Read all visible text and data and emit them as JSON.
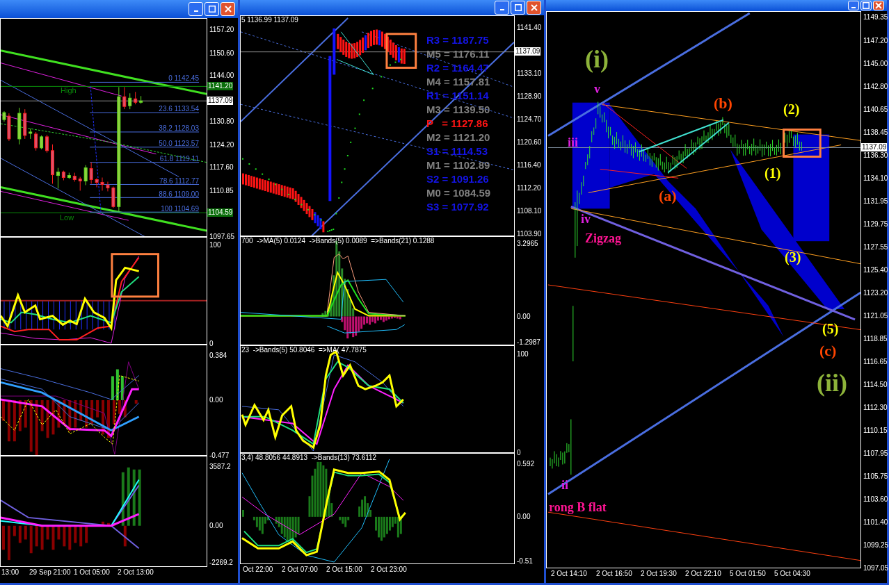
{
  "windows": [
    {
      "panes": [
        {
          "yticks": [
            "1157.20",
            "1150.60",
            "1144.00",
            "1130.80",
            "1124.20",
            "1117.60",
            "1110.85",
            "1097.65"
          ],
          "badges": [
            {
              "text": "1141.20",
              "kind": "level"
            },
            {
              "text": "1137.09",
              "kind": "current"
            },
            {
              "text": "1104.59",
              "kind": "level"
            }
          ],
          "labels": [
            {
              "text": "High"
            },
            {
              "text": "Low"
            }
          ],
          "fib_levels": [
            "0 1142.45",
            "23.6 1133.54",
            "38.2 1128.03",
            "50.0 1123.57",
            "61.8 1119.11",
            "78.6 1112.77",
            "88.6 1109.00",
            "100 1104.69"
          ]
        },
        {
          "yticks": [
            "100",
            "0"
          ]
        },
        {
          "yticks": [
            "0.384",
            "0.00",
            "-0.477"
          ]
        },
        {
          "yticks": [
            "3587.2",
            "0.00",
            "-2269.2"
          ]
        }
      ],
      "time_axis": [
        "13:00",
        "29 Sep 21:00",
        "1 Oct 05:00",
        "2 Oct 13:00"
      ]
    },
    {
      "panes": [
        {
          "header": "5 1136.99 1137.09",
          "yticks": [
            "1141.40",
            "1133.10",
            "1128.90",
            "1124.70",
            "1120.60",
            "1116.40",
            "1112.20",
            "1108.10",
            "1103.90"
          ],
          "badges": [
            {
              "text": "1137.09",
              "kind": "current"
            }
          ],
          "pivots": [
            {
              "text": "R3 = 1187.75",
              "color": "#1414e6"
            },
            {
              "text": "M5 = 1176.11",
              "color": "#808080"
            },
            {
              "text": "R2 = 1164.47",
              "color": "#1414e6"
            },
            {
              "text": "M4 = 1157.81",
              "color": "#808080"
            },
            {
              "text": "R1 = 1151.14",
              "color": "#1414e6"
            },
            {
              "text": "M3 = 1139.50",
              "color": "#808080"
            },
            {
              "text": "P   = 1127.86",
              "color": "#ff1414"
            },
            {
              "text": "M2 = 1121.20",
              "color": "#808080"
            },
            {
              "text": "S1 = 1114.53",
              "color": "#1414e6"
            },
            {
              "text": "M1 = 1102.89",
              "color": "#808080"
            },
            {
              "text": "S2 = 1091.26",
              "color": "#1414e6"
            },
            {
              "text": "M0 = 1084.59",
              "color": "#808080"
            },
            {
              "text": "S3 = 1077.92",
              "color": "#1414e6"
            }
          ]
        },
        {
          "header": "700  ->MA(5) 0.0124  ->Bands(5) 0.0089  =>Bands(21) 0.1288",
          "yticks": [
            "3.2965",
            "0.00",
            "-1.2987"
          ]
        },
        {
          "header": "23  ->Bands(5) 50.8046  =>MA( 47.7875",
          "yticks": [
            "100",
            "0"
          ]
        },
        {
          "header": "3,4) 48.8056 44.8913  ->Bands(13) 73.6112",
          "yticks": [
            "0.592",
            "0.00",
            "-0.51"
          ]
        }
      ],
      "time_axis": [
        "Oct 22:00",
        "2 Oct 07:00",
        "2 Oct 15:00",
        "2 Oct 23:00"
      ]
    },
    {
      "panes": [
        {
          "yticks": [
            "1149.35",
            "1147.20",
            "1145.00",
            "1142.80",
            "1140.65",
            "1138.45",
            "1136.30",
            "1134.10",
            "1131.95",
            "1129.75",
            "1127.55",
            "1125.40",
            "1123.20",
            "1121.05",
            "1118.85",
            "1116.65",
            "1114.50",
            "1112.30",
            "1110.15",
            "1107.95",
            "1105.75",
            "1103.60",
            "1101.40",
            "1099.25",
            "1097.05"
          ],
          "badges": [
            {
              "text": "1137.09",
              "kind": "current"
            }
          ],
          "wave_labels": [
            {
              "text": "(i)",
              "color": "#8db33a"
            },
            {
              "text": "v",
              "color": "#e020e0"
            },
            {
              "text": "iii",
              "color": "#e020e0"
            },
            {
              "text": "iv",
              "color": "#e020e0"
            },
            {
              "text": "Zigzag",
              "color": "#ff1493"
            },
            {
              "text": "(b)",
              "color": "#ff4500"
            },
            {
              "text": "(2)",
              "color": "#ffff00"
            },
            {
              "text": "(a)",
              "color": "#ff4500"
            },
            {
              "text": "(1)",
              "color": "#ffff00"
            },
            {
              "text": "(3)",
              "color": "#ffff00"
            },
            {
              "text": "(5)",
              "color": "#ffff00"
            },
            {
              "text": "(c)",
              "color": "#ff4500"
            },
            {
              "text": "(ii)",
              "color": "#8db33a"
            },
            {
              "text": "ii",
              "color": "#e020e0"
            },
            {
              "text": "rong B flat",
              "color": "#ff1493"
            }
          ]
        }
      ],
      "time_axis": [
        "2 Oct 14:10",
        "2 Oct 16:50",
        "2 Oct 19:30",
        "2 Oct 22:10",
        "5 Oct 01:50",
        "5 Oct 04:30"
      ]
    }
  ]
}
